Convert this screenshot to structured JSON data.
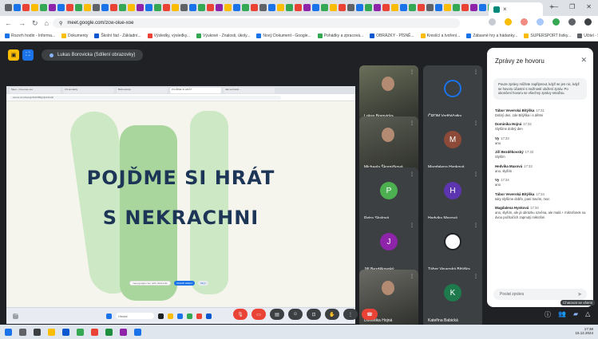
{
  "browser": {
    "active_tab_close": "×",
    "new_tab": "+",
    "window_controls": [
      "—",
      "❐",
      "✕"
    ],
    "url": "meet.google.com/zcw-oiue-xoe",
    "bookmarks": [
      {
        "label": "Rozvrh hodin - Informa..."
      },
      {
        "label": "Dokumenty"
      },
      {
        "label": "Školní řád - Základní..."
      },
      {
        "label": "Výsledky, výsledky..."
      },
      {
        "label": "Výukové - Znalosti, úkoly..."
      },
      {
        "label": "Nový Dokument - Google..."
      },
      {
        "label": "Pohádky a zpracová..."
      },
      {
        "label": "OBRÁZKY - PÍSNĚ..."
      },
      {
        "label": "Kreslící a tvoření..."
      },
      {
        "label": "Zábavné hry a hádanky..."
      },
      {
        "label": "SUPERSPORT lístky..."
      },
      {
        "label": "Učitel - Speciální..."
      },
      {
        "label": "»"
      },
      {
        "label": "Všechny záložky"
      }
    ]
  },
  "meet": {
    "presenter_label": "Lukas Borovicka (Sdílení obrazovky)",
    "slide_line1": "POJĎME SI HRÁT",
    "slide_line2": "S NEKRACHNI",
    "share_pill_1": "meet.google.com sdílí obrazovku",
    "share_pill_2": "Ukončit sdílení",
    "share_pill_3": "Skrýt",
    "slide_tabs": [
      "Meet - zcw-oiue-xoe",
      "CS kontakty",
      "Bobrovánky",
      "POJĎME SI HRÁT",
      "Jak se bránit..."
    ],
    "slide_url": "canva.com/design/DAF9BqpQHr4/edit",
    "slide_search": "Hledat",
    "time": "17:35",
    "meeting_code": "zcw-oiue-xoe",
    "tooltip": "Chatovat se všemi"
  },
  "participants": [
    {
      "name": "Lukas Borovicka",
      "initial": "",
      "color": "#6a6f5a"
    },
    {
      "name": "ČRDM Vodňáčatky",
      "initial": "",
      "color": "#3c4043"
    },
    {
      "name": "Michaela Škorničková",
      "initial": "",
      "color": "#5b5e53"
    },
    {
      "name": "Magdalena Hynková",
      "initial": "M",
      "color": "#8d4a38"
    },
    {
      "name": "Petra Skalová",
      "initial": "P",
      "color": "#4caf50"
    },
    {
      "name": "Hedvika Maxová",
      "initial": "H",
      "color": "#5e35b1"
    },
    {
      "name": "Jiří Bezděkovský",
      "initial": "J",
      "color": "#8e24aa"
    },
    {
      "name": "Tábor Veverská Bítýška",
      "initial": "",
      "color": "#ffffff"
    },
    {
      "name": "Dominika Hojná",
      "initial": "",
      "color": "#6b6b66"
    },
    {
      "name": "Kateřina Babická",
      "initial": "K",
      "color": "#1e7a4d"
    }
  ],
  "chat": {
    "title": "Zprávy ze hovoru",
    "info": "Pouze zprávy můžete zapřipnout, když se jen nic, když se hovoru účastní s možností uložení zpráv. Po ukončení hovoru se všechny zprávy smažou.",
    "input_placeholder": "Poslat zprávu",
    "messages": [
      {
        "sender": "Tábor Veverská Bítýška",
        "time": "17:31",
        "text": "Dobrý den, zde Bítýška i s dětmi"
      },
      {
        "sender": "Dominika Hojná",
        "time": "17:32",
        "text": "Slyšíme dobrý den"
      },
      {
        "sender": "Vy",
        "time": "17:33",
        "text": "ano"
      },
      {
        "sender": "Jiří Bezděkovský",
        "time": "17:33",
        "text": "Slyším"
      },
      {
        "sender": "Hedvika Maxová",
        "time": "17:33",
        "text": "ano, slyším"
      },
      {
        "sender": "Vy",
        "time": "17:34",
        "text": "ano"
      },
      {
        "sender": "Tábor Veverská Bítýška",
        "time": "17:34",
        "text": "taky slyšíme dobře, paní travím, moc"
      },
      {
        "sender": "Magdalena Hynková",
        "time": "17:34",
        "text": "ano, slyším, ale já obrázku ozvěna, ale malá + mikrofonek na dvou počítačích zapnutý mikrofon"
      }
    ]
  },
  "taskbar": {
    "clock_time": "17:38",
    "clock_date": "15.12.2024"
  }
}
